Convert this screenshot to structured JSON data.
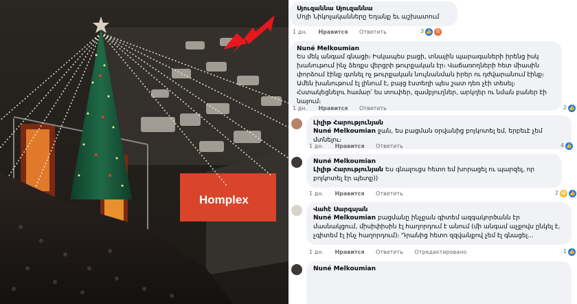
{
  "photo": {
    "store_sign": "Hompleх"
  },
  "comments": [
    {
      "author": "Սյուզաննա Սյուզաննա",
      "text": "Մոյի Նիկոլականները Եղանք եւ աշխատում",
      "time": "1 дн.",
      "like": "Нравится",
      "reply": "Ответить",
      "reaction_count": "3"
    },
    {
      "author": "Nuné Melkoumian",
      "text": "Ես մեկ անգամ գնացի։ Իսկապես բացի, տնային պարագաների իրենց իսկ խանութում ինչ ձեռքս վերցրի թուրքական էր։ Վաճառողների հետ միասին փորձում էինք գտնել ոչ թուրքական նույնանման իրեր ու դժվարանում էինք։ Ամեն խանութում էլ լինում է, բայց էստեղի պես շատ դեռ չէի տեսել։ Հստակեցնելու համար՝ ես տուփեր, զամբյուղներ, արկղեր ու նման բաներ էի նայում։",
      "time": "1 дн.",
      "like": "Нравится",
      "reply": "Ответить",
      "reaction_count": "2"
    },
    {
      "author": "Լիլիթ Հարությունյան",
      "text_name": "Nuné Melkoumian",
      "text": " ջան, ես բացման օրվանից բոյկոտել եմ, երբեւէ չեմ մտնելու։",
      "time": "1 дн.",
      "like": "Нравится",
      "reply": "Ответить",
      "reaction_count": "4"
    },
    {
      "author": "Nuné Melkoumian",
      "text_name": "Լիլիթ Հարությունյան",
      "text": " Ես գնալուցս հետո եմ խորացել ու պարզել, որ բոյկոտել էր պետք))",
      "time": "1 дн.",
      "like": "Нравится",
      "reply": "Ответить",
      "reaction_count": "2"
    },
    {
      "author": "Վաhէ Սարգսյան",
      "text_name": "Nuné Melkoumian",
      "text": " բացմանը ինչքան գիտեմ ազգակործանն էր մասնակցում, միսիփիսին էլ հաղորդում է անում (մի անգամ աչքովս ընկել է, չգիտեմ էլ ինչ հաղորդում)։ Դրանից հետո զզվանքով չեմ էլ գնացել...",
      "time": "1 дн.",
      "like": "Нравится",
      "reply": "Ответить",
      "edited": "Отредактировано",
      "reaction_count": "1"
    },
    {
      "author": "Nuné Melkoumian"
    }
  ],
  "colors": {
    "link_blue": "#1877f2",
    "bubble_bg": "#f0f2f5",
    "secondary_text": "#65676b",
    "arrow_red": "#e8161d"
  }
}
